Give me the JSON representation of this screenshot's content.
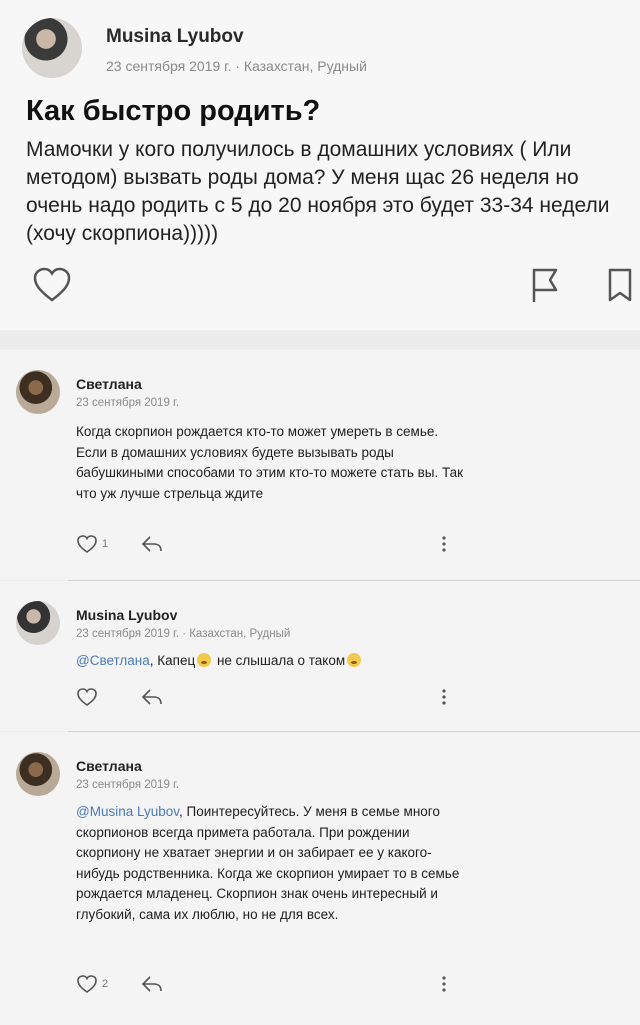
{
  "post": {
    "author": "Musina Lyubov",
    "meta": "23 сентября 2019 г. · Казахстан, Рудный",
    "title": "Как быстро родить?",
    "body": "Мамочки у кого получилось в домашних условиях ( Или методом) вызвать роды дома? У меня щас 26 неделя но очень надо родить с 5 до 20 ноября это будет 33-34 недели (хочу скорпиона)))))"
  },
  "comments": [
    {
      "author": "Светлана",
      "date": "23 сентября 2019 г.",
      "text": "Когда скорпион рождается кто-то может умереть в семье. Если в домашних условиях будете вызывать роды бабушкиными способами то этим кто-то можете стать вы. Так что уж лучше стрельца ждите",
      "likes": "1"
    },
    {
      "author": "Musina Lyubov",
      "date": "23 сентября 2019 г. · Казахстан, Рудный",
      "mention": "@Светлана",
      "text_part1": ", Капец",
      "text_part2": " не слышала о таком"
    },
    {
      "author": "Светлана",
      "date": "23 сентября 2019 г.",
      "mention": "@Musina Lyubov",
      "text": ", Поинтересуйтесь. У меня в семье много скорпионов всегда примета работала. При рождении скорпиону не хватает энергии и он забирает ее у какого-нибудь родственника. Когда же скорпион умирает то в семье рождается младенец. Скорпион знак очень интересный и глубокий, сама их люблю, но не для всех.",
      "likes": "2"
    }
  ],
  "icons": {
    "like": "heart-icon",
    "report": "flag-icon",
    "save": "bookmark-icon",
    "reply": "reply-icon",
    "more": "more-vertical-icon"
  }
}
